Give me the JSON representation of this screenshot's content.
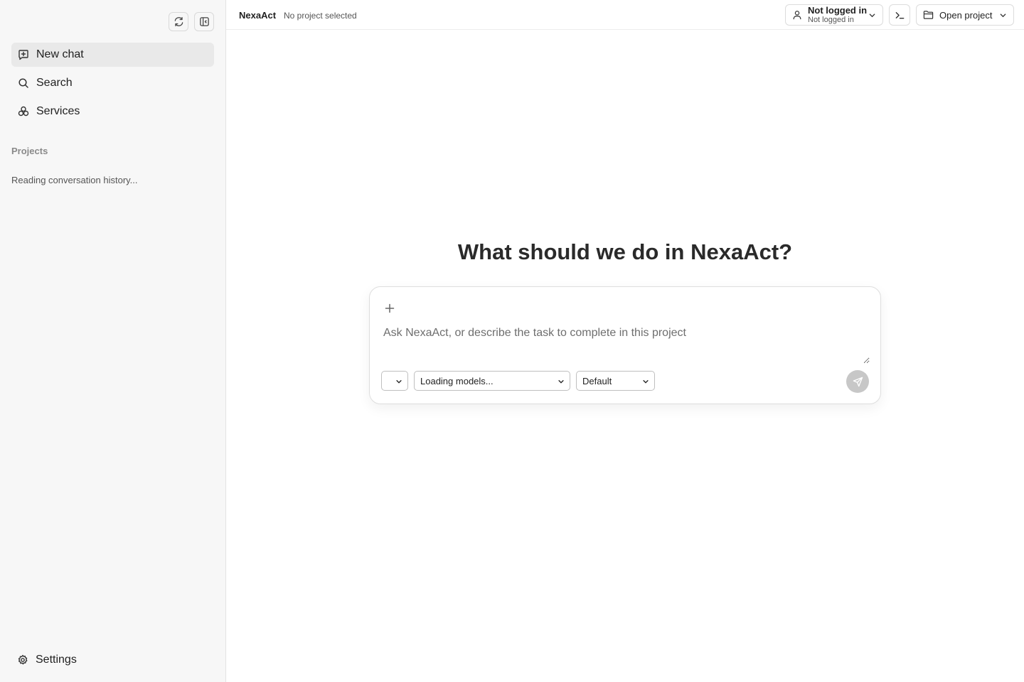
{
  "sidebar": {
    "nav_items": [
      {
        "label": "New chat",
        "icon": "new-chat-icon"
      },
      {
        "label": "Search",
        "icon": "search-icon"
      },
      {
        "label": "Services",
        "icon": "services-icon"
      }
    ],
    "projects_label": "Projects",
    "loading_text": "Reading conversation history...",
    "settings_label": "Settings"
  },
  "topbar": {
    "app_name": "NexaAct",
    "project_status": "No project selected",
    "login": {
      "main": "Not logged in",
      "sub": "Not logged in"
    },
    "open_project_label": "Open project"
  },
  "main": {
    "headline": "What should we do in NexaAct?",
    "composer": {
      "placeholder": "Ask NexaAct, or describe the task to complete in this project",
      "first_select_value": "",
      "model_select_value": "Loading models...",
      "mode_select_value": "Default"
    }
  },
  "colors": {
    "sidebar_bg": "#f7f7f7",
    "active_item_bg": "#e9e9e9",
    "send_button_bg": "#c7c7c7"
  }
}
